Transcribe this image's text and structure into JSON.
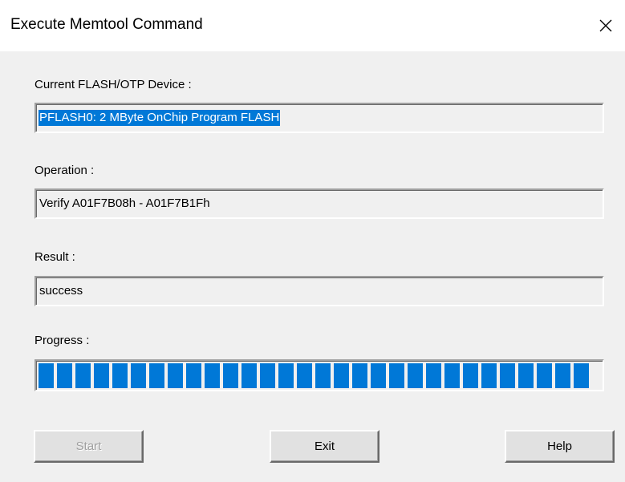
{
  "window": {
    "title": "Execute Memtool Command"
  },
  "device": {
    "label": "Current FLASH/OTP Device :",
    "value": "PFLASH0: 2 MByte OnChip Program FLASH"
  },
  "operation": {
    "label": "Operation :",
    "value": "Verify A01F7B08h - A01F7B1Fh"
  },
  "result": {
    "label": "Result :",
    "value": "success"
  },
  "progress": {
    "label": "Progress :",
    "percent": 100,
    "bar_color": "#0078d7"
  },
  "buttons": {
    "start_label": "Start",
    "exit_label": "Exit",
    "help_label": "Help"
  },
  "icons": {
    "close": "close-icon"
  }
}
